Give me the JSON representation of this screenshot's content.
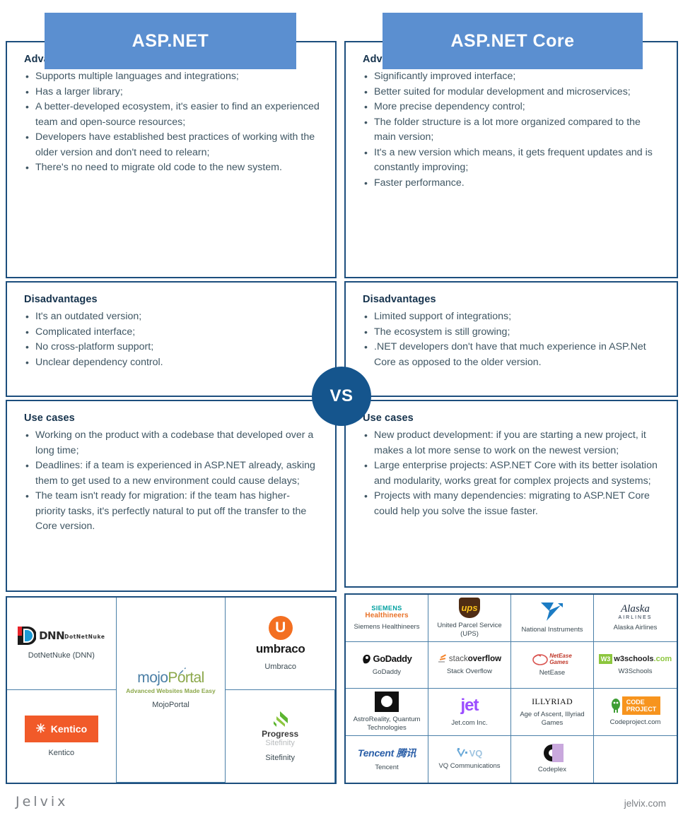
{
  "colors": {
    "banner": "#5b8fd0",
    "frame_border": "#1c4e7d",
    "vs_badge": "#15558d",
    "body_text": "#3f5663",
    "heading": "#16334d"
  },
  "columns": [
    {
      "id": "aspnet",
      "title": "ASP.NET",
      "sections": [
        {
          "heading": "Advantages",
          "items": [
            "Supports multiple languages and integrations;",
            "Has a larger library;",
            "A better-developed ecosystem, it's easier to find an experienced team and open-source resources;",
            "Developers have established best practices of working with the older version and don't need to relearn;",
            "There's no need to migrate old code to the new system."
          ]
        },
        {
          "heading": "Disadvantages",
          "items": [
            "It's an outdated version;",
            "Complicated interface;",
            "No cross-platform support;",
            "Unclear dependency control."
          ]
        },
        {
          "heading": "Use cases",
          "items": [
            "Working on the product with a codebase that developed over a long time;",
            "Deadlines: if a team is experienced in ASP.NET already, asking them to get used to a new environment could cause delays;",
            "The team isn't ready for migration: if the team has higher-priority tasks, it's perfectly natural to put off the transfer to the Core version."
          ]
        }
      ],
      "logos": [
        {
          "name": "DotNetNuke (DNN)",
          "mark": "dnn-logo"
        },
        {
          "name": "MojoPortal",
          "mark": "mojoportal-logo"
        },
        {
          "name": "Umbraco",
          "mark": "umbraco-logo"
        },
        {
          "name": "Kentico",
          "mark": "kentico-logo"
        },
        {
          "name": "Sitefinity",
          "mark": "sitefinity-logo"
        }
      ]
    },
    {
      "id": "aspnetcore",
      "title": "ASP.NET Core",
      "sections": [
        {
          "heading": "Advantages",
          "items": [
            "Significantly improved interface;",
            "Better suited for modular development and microservices;",
            "More precise dependency control;",
            "The folder structure is a lot more organized compared to the main version;",
            "It's a new version which means, it gets frequent updates and is constantly improving;",
            "Faster performance."
          ]
        },
        {
          "heading": "Disadvantages",
          "items": [
            "Limited support of integrations;",
            "The ecosystem is still growing;",
            ".NET developers don't have that much experience in ASP.Net Core as opposed to the older version."
          ]
        },
        {
          "heading": "Use cases",
          "items": [
            "New product development: if you are starting a new project, it makes a lot more sense to work on the newest version;",
            "Large enterprise projects: ASP.NET Core with its better isolation and modularity, works great for complex projects and systems;",
            "Projects with many dependencies: migrating to ASP.NET Core could help you solve the issue faster."
          ]
        }
      ],
      "logos": [
        {
          "name": "Siemens Healthineers",
          "mark": "siemens-healthineers-logo"
        },
        {
          "name": "United Parcel Service (UPS)",
          "mark": "ups-logo"
        },
        {
          "name": "National Instruments",
          "mark": "national-instruments-logo"
        },
        {
          "name": "Alaska Airlines",
          "mark": "alaska-airlines-logo"
        },
        {
          "name": "GoDaddy",
          "mark": "godaddy-logo"
        },
        {
          "name": "Stack Overflow",
          "mark": "stackoverflow-logo"
        },
        {
          "name": "NetEase",
          "mark": "netease-logo"
        },
        {
          "name": "W3Schools",
          "mark": "w3schools-logo"
        },
        {
          "name": "AstroReality, Quantum Technologies",
          "mark": "astroreality-logo"
        },
        {
          "name": "Jet.com Inc.",
          "mark": "jet-logo"
        },
        {
          "name": "Age of Ascent, Illyriad Games",
          "mark": "illyriad-logo"
        },
        {
          "name": "Codeproject.com",
          "mark": "codeproject-logo"
        },
        {
          "name": "Tencent",
          "mark": "tencent-logo"
        },
        {
          "name": "VQ Communications",
          "mark": "vq-logo"
        },
        {
          "name": "Codeplex",
          "mark": "codeplex-logo"
        },
        {
          "name": "",
          "mark": ""
        }
      ]
    }
  ],
  "vs_label": "VS",
  "footer": {
    "brand": "Jelvix",
    "site": "jelvix.com"
  },
  "logo_text": {
    "dnn_word": "DNN",
    "dnn_sub": "DotNetNuke",
    "mojo_a": "mojo",
    "mojo_b": "Portal",
    "mojo_sub": "Advanced Websites Made Easy",
    "umbraco": "umbraco",
    "umbraco_glyph": "U",
    "kentico": "Kentico",
    "kentico_glyph": "✳",
    "progress": "Progress",
    "sitefinity": "Sitefinity",
    "siemens_1": "SIEMENS",
    "siemens_2": "Healthineers",
    "ups": "ups",
    "alaska_1": "Alaska",
    "alaska_2": "AIRLINES",
    "godaddy": "GoDaddy",
    "so_1": "stack",
    "so_2": "overflow",
    "netease_1": "NetEase",
    "netease_2": "Games",
    "w3_mark": "W3",
    "w3_txt": "w3schools",
    "w3_com": ".com",
    "jet": "jet",
    "illyriad": "ILLYRIAD",
    "cp_1": "CODE",
    "cp_2": "PROJECT",
    "tencent": "Tencent 腾讯",
    "vq": "VQ",
    "codeplex": "C"
  }
}
